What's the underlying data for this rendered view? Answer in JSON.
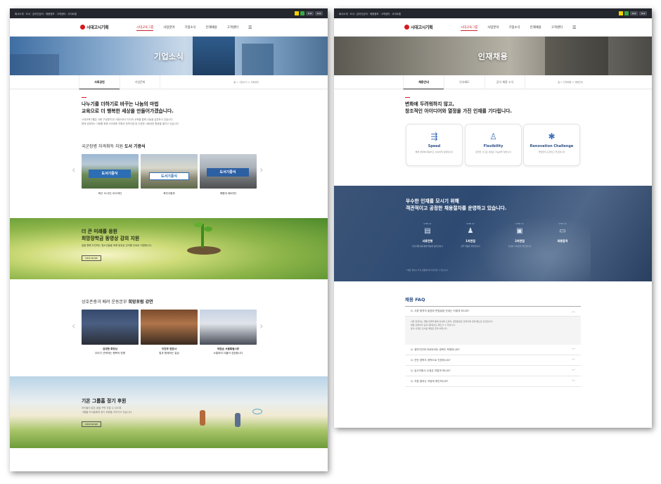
{
  "left": {
    "topbar": {
      "links": "회사소개 · 도서 · 온라인강의 · 채용정보 · 고객센터 · 사이트맵"
    },
    "logo_text": "시대고시기획",
    "menu": [
      "시대교육그룹",
      "사업분야",
      "기업소식",
      "인재채용",
      "고객센터"
    ],
    "hero_title": "기업소식",
    "subtabs": [
      "사회공헌",
      "기업문화"
    ],
    "breadcrumb": "홈 > 기업소식 > 사회공헌",
    "intro": {
      "line1": "나누기를 더하기로 바꾸는 나눔의 마법",
      "line2": "교육으로 더 행복한 세상을 만들어가겠습니다.",
      "desc1": "시대교육그룹은 사회 구성원의 한 사람으로서 지식과 교육을 통해 나눔을 실천하고 있습니다.",
      "desc2": "함께 성장하는 사회를 위해 소외계층 지원과 장학사업 등 다양한 사회공헌 활동을 펼치고 있습니다."
    },
    "book_section": {
      "title_plain": "국군장병 자격취득 지원",
      "title_bold": "도서 기증식",
      "captions": [
        "육군 31사단 502여단",
        "육전사령부",
        "해병대 제6여단"
      ],
      "banners": [
        "도서기증식",
        "도서기증식",
        "도서기증식"
      ]
    },
    "scholarship": {
      "line1": "더 큰 미래를 응원",
      "line2": "희망장학금 동영상 강의 지원",
      "desc": "꿈을 향해 도전하는 청소년들을 위해 동영상 강의를 무료로 지원합니다.",
      "button": "VIEW MORE"
    },
    "lecture_section": {
      "title_plain": "상호존중과 배려 운동본부",
      "title_bold": "희망포럼 강연",
      "people": [
        {
          "name": "김대현 회장님",
          "desc": "우리가 선택하는 행복의 방향"
        },
        {
          "name": "이진우 변호사",
          "desc": "법과 함께하는 일상"
        },
        {
          "name": "박원순 서울특별시장",
          "desc": "소통하여 더불어 성장합니다"
        }
      ]
    },
    "sponsor": {
      "title": "기온 그룹홈 정기 후원",
      "desc1": "아이들이 밝은 꿈을 꾸며 자랄 수 있도록",
      "desc2": "그룹홈 아이들에게 정기 후원을 이어가고 있습니다.",
      "button": "VIEW MORE"
    }
  },
  "right": {
    "topbar": {
      "links": "회사소개 · 도서 · 온라인강의 · 채용정보 · 고객센터 · 사이트맵"
    },
    "logo_text": "시대고시기획",
    "menu": [
      "시대교육그룹",
      "사업분야",
      "기업소식",
      "인재채용",
      "고객센터"
    ],
    "hero_title": "인재채용",
    "subtabs": [
      "채용안내",
      "인사제도",
      "공식 채용 소식"
    ],
    "breadcrumb": "홈 > 인재채용 > 채용안내",
    "intro": {
      "line1": "변화에 두려워하지 않고,",
      "line2": "창조적인 아이디어와 열정을 가진 인재를 기다립니다."
    },
    "values": [
      {
        "title": "Speed",
        "icon": "speed-icon",
        "desc": "빠른 변화에 대응하고 신속하게 실행합니다"
      },
      {
        "title": "Flexibility",
        "icon": "people-icon",
        "desc": "유연한 사고로 새로운 가능성을 찾습니다"
      },
      {
        "title": "Renovation Challenge",
        "icon": "bulb-icon",
        "desc": "끊임없이 도전하고 혁신합니다"
      }
    ],
    "process": {
      "line1": "우수한 인재를 모시기 위해",
      "line2": "객관적이고 공정한 채용절차를 운영하고 있습니다.",
      "steps": [
        {
          "no": "STEP 01",
          "title": "서류전형",
          "desc": "입사지원서를 통해 역량을 평가합니다"
        },
        {
          "no": "STEP 02",
          "title": "1차면접",
          "desc": "실무 역량을 확인합니다"
        },
        {
          "no": "STEP 03",
          "title": "2차면접",
          "desc": "인성과 가치관을 확인합니다"
        },
        {
          "no": "STEP 04",
          "title": "최종합격",
          "desc": ""
        }
      ],
      "note": "* 채용 절차는 부서 상황에 따라 변경될 수 있습니다."
    },
    "faq": {
      "title": "채용 FAQ",
      "items": [
        "Q. 서류 합격자 발표와 면접일정 안내는 어떻게 하나요?",
        "Q. 경력기간에 아르바이트 경력도 포함되나요?",
        "Q. 인턴 경력도 경력으로 인정되나요?",
        "Q. 입사지원서 수정은 어떻게 하나요?",
        "Q. 지원 결과는 어떻게 확인하나요?"
      ],
      "answer": [
        "서류 합격자는 개별 연락을 통해 안내해 드리며, 면접일정은 합격자에 한해 별도로 안내합니다.",
        "채용 홈페이지 공지사항에서도 확인할 수 있습니다.",
        "문의 사항은 인사팀 메일로 연락 바랍니다."
      ]
    }
  },
  "colors": {
    "brand_red": "#d71920",
    "nav_dark": "#25272e",
    "recruit_blue": "#2e4a72"
  }
}
